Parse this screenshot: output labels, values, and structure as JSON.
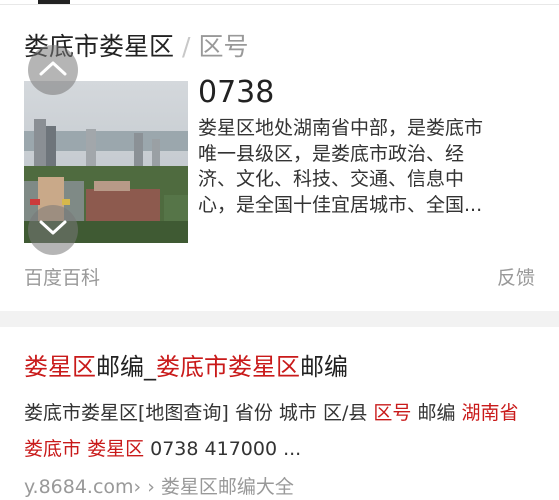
{
  "card": {
    "title": "娄底市娄星区",
    "separator": "/",
    "subtitle": "区号",
    "code": "0738",
    "desc_lines": [
      "娄星区地处湖南省中部，是娄底市",
      "唯一县级区，是娄底市政治、经",
      "济、文化、科技、交通、信息中",
      "心，是全国十佳宜居城市、全国..."
    ],
    "source": "百度百科",
    "feedback": "反馈"
  },
  "result": {
    "title_parts": [
      "娄星区",
      "邮编_",
      "娄底市娄星区",
      "邮编"
    ],
    "snippet_parts": [
      "娄底市娄星区[地图查询] 省份 城市 区/县 ",
      "区号",
      " 邮编 ",
      "湖南省",
      " ",
      "娄底市",
      " ",
      "娄星区",
      " 0738 417000 ..."
    ],
    "url": "y.8684.com›",
    "breadcrumb": "› 娄星区邮编大全"
  },
  "icons": {
    "up": "chevron-up-icon",
    "down": "chevron-down-icon"
  },
  "colors": {
    "highlight": "#c91a1a",
    "muted": "#999999",
    "divider": "#f2f2f2"
  }
}
